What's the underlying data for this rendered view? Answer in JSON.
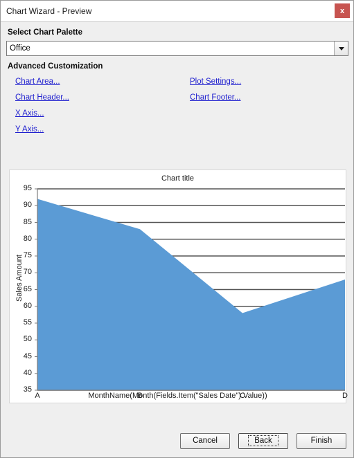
{
  "window": {
    "title": "Chart Wizard - Preview",
    "close_label": "x",
    "close_color": "#c75450"
  },
  "palette": {
    "label": "Select Chart Palette",
    "value": "Office",
    "placeholder": "Office",
    "arrow_icon": "chevron-down-icon",
    "options": [
      "Office"
    ]
  },
  "advanced": {
    "label": "Advanced Customization",
    "links_left": [
      {
        "label": "Chart Area..."
      },
      {
        "label": "Chart Header..."
      },
      {
        "label": "X Axis..."
      },
      {
        "label": "Y Axis..."
      }
    ],
    "links_right": [
      {
        "label": "Plot Settings..."
      },
      {
        "label": "Chart Footer..."
      }
    ],
    "link_color": "#2020cf"
  },
  "footer": {
    "cancel_label": "Cancel",
    "back_label": "Back",
    "finish_label": "Finish"
  },
  "chart_data": {
    "type": "area",
    "title": "Chart title",
    "xlabel": "MonthName(Month(Fields.Item(\"Sales Date\").Value))",
    "ylabel": "Sales Amount",
    "categories": [
      "A",
      "B",
      "C",
      "D"
    ],
    "values": [
      92,
      83,
      58,
      68
    ],
    "series": [
      {
        "name": "Sales Amount",
        "values": [
          92,
          83,
          58,
          68
        ],
        "color": "#5b9bd5"
      }
    ],
    "ylim": [
      35,
      95
    ],
    "ytick_step": 5,
    "yticks": [
      35,
      40,
      45,
      50,
      55,
      60,
      65,
      70,
      75,
      80,
      85,
      90,
      95
    ],
    "grid": true,
    "gridline_color": "#555555",
    "legend": "none",
    "fill_color": "#5b9bd5",
    "plot_background": "#ffffff"
  }
}
